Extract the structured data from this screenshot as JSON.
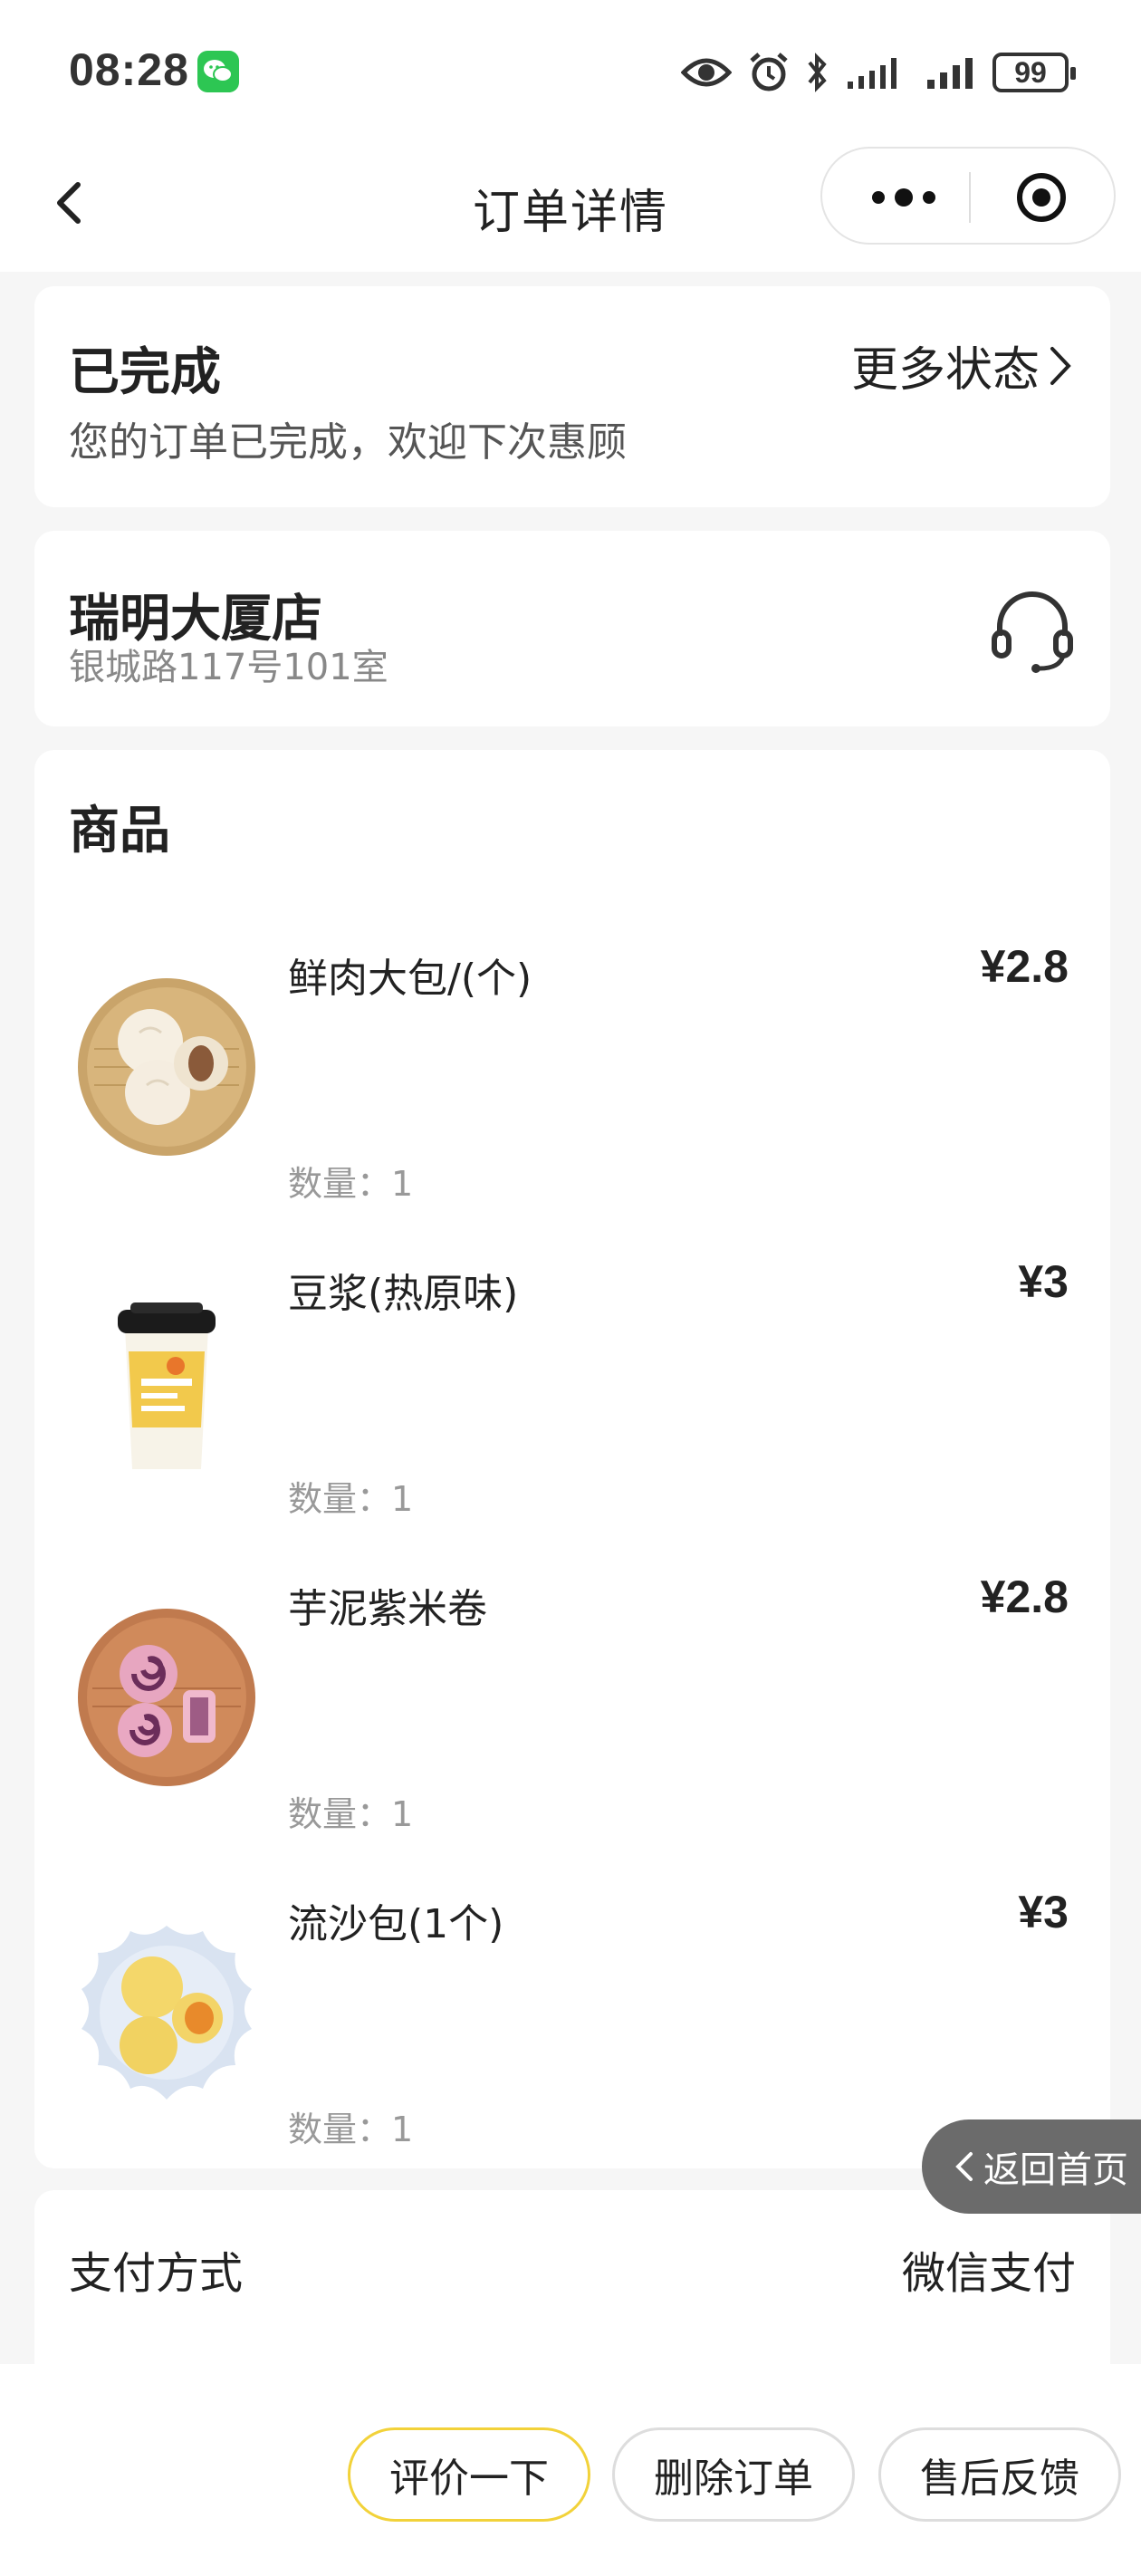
{
  "status_bar": {
    "time": "08:28",
    "battery": "99"
  },
  "nav": {
    "title": "订单详情"
  },
  "order_status": {
    "title": "已完成",
    "subtitle": "您的订单已完成，欢迎下次惠顾",
    "more_label": "更多状态"
  },
  "store": {
    "name": "瑞明大厦店",
    "address": "银城路117号101室",
    "service_icon": "headset-icon"
  },
  "goods": {
    "title": "商品",
    "items": [
      {
        "name": "鲜肉大包/(个)",
        "price": "¥2.8",
        "qty": "数量：1",
        "image": "meat-bun"
      },
      {
        "name": "豆浆(热原味)",
        "price": "¥3",
        "qty": "数量：1",
        "image": "soy-milk-cup"
      },
      {
        "name": "芋泥紫米卷",
        "price": "¥2.8",
        "qty": "数量：1",
        "image": "taro-roll"
      },
      {
        "name": "流沙包(1个)",
        "price": "¥3",
        "qty": "数量：1",
        "image": "custard-bun"
      }
    ]
  },
  "payment": {
    "label": "支付方式",
    "value": "微信支付"
  },
  "float_home": {
    "label": "返回首页"
  },
  "actions": {
    "review": "评价一下",
    "delete": "删除订单",
    "after_sales": "售后反馈"
  },
  "colors": {
    "accent_border": "#f2d23a",
    "wechat_green": "#2dc653",
    "float_bg": "#6b6b6b"
  }
}
